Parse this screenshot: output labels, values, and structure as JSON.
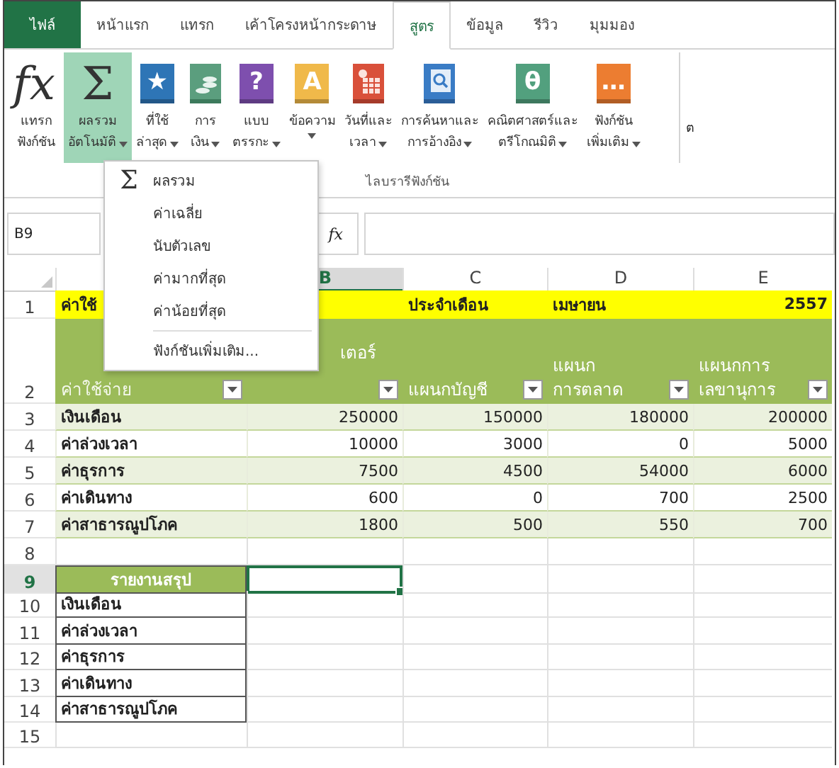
{
  "tabs": [
    {
      "label": "ไฟล์",
      "kind": "file",
      "selected": false
    },
    {
      "label": "หน้าแรก",
      "kind": "tab",
      "selected": false
    },
    {
      "label": "แทรก",
      "kind": "tab",
      "selected": false
    },
    {
      "label": "เค้าโครงหน้ากระดาษ",
      "kind": "tab",
      "selected": false
    },
    {
      "label": "สูตร",
      "kind": "tab",
      "selected": true
    },
    {
      "label": "ข้อมูล",
      "kind": "tab",
      "selected": false
    },
    {
      "label": "รีวิว",
      "kind": "tab",
      "selected": false
    },
    {
      "label": "มุมมอง",
      "kind": "tab",
      "selected": false
    }
  ],
  "ribbon": {
    "buttons": [
      {
        "kind": "plain",
        "glyph": "fx",
        "line1": "แทรก",
        "line2": "ฟังก์ชัน",
        "has_menu": false,
        "selected": false
      },
      {
        "kind": "plain",
        "glyph": "Σ",
        "line1": "ผลรวม",
        "line2": "อัตโนมัติ",
        "has_menu": true,
        "selected": true
      },
      {
        "kind": "book",
        "glyph": "★",
        "color": "#2e75b6",
        "line1": "ที่ใช้",
        "line2": "ล่าสุด",
        "has_menu": true,
        "selected": false
      },
      {
        "kind": "coins",
        "color": "#5b9e7e",
        "line1": "การ",
        "line2": "เงิน",
        "has_menu": true,
        "selected": false
      },
      {
        "kind": "book",
        "glyph": "?",
        "color": "#7e4fae",
        "line1": "แบบ",
        "line2": "ตรรกะ",
        "has_menu": true,
        "selected": false
      },
      {
        "kind": "book",
        "glyph": "A",
        "color": "#f0b94a",
        "line1": "ข้อความ",
        "has_menu": true,
        "selected": false
      },
      {
        "kind": "calendar",
        "color": "#d9503a",
        "line1": "วันที่และ",
        "line2": "เวลา",
        "has_menu": true,
        "selected": false
      },
      {
        "kind": "search",
        "color": "#3a7cc5",
        "line1": "การค้นหาและ",
        "line2": "การอ้างอิง",
        "has_menu": true,
        "selected": false
      },
      {
        "kind": "book",
        "glyph": "θ",
        "color": "#52a07e",
        "line1": "คณิตศาสตร์และ",
        "line2": "ตรีโกณมิติ",
        "has_menu": true,
        "selected": false
      },
      {
        "kind": "book",
        "glyph": "…",
        "color": "#ec7d31",
        "line1": "ฟังก์ชัน",
        "line2": "เพิ่มเติม",
        "has_menu": true,
        "selected": false
      }
    ],
    "group_label": "ไลบรารีฟังก์ชัน",
    "cut_label": "ต"
  },
  "menu": {
    "items": [
      {
        "label": "ผลรวม",
        "glyph": "Σ"
      },
      {
        "label": "ค่าเฉลี่ย"
      },
      {
        "label": "นับตัวเลข"
      },
      {
        "label": "ค่ามากที่สุด"
      },
      {
        "label": "ค่าน้อยที่สุด"
      }
    ],
    "more": "ฟังก์ชันเพิ่มเติม..."
  },
  "formula_bar": {
    "name_box": "B9",
    "fx": "fx"
  },
  "sheet": {
    "columns": [
      {
        "label": "B",
        "selected": true
      },
      {
        "label": "C",
        "selected": false
      },
      {
        "label": "D",
        "selected": false
      },
      {
        "label": "E",
        "selected": false
      }
    ],
    "rows": [
      {
        "num": "1",
        "kind": "title",
        "selected": false,
        "cells": [
          "ค่าใช้",
          null,
          "ประจำเดือน",
          "เมษายน",
          "2557"
        ]
      },
      {
        "num": "2",
        "kind": "header",
        "selected": false,
        "cells": [
          "ค่าใช้จ่าย",
          "เตอร์",
          "แผนกบัญชี",
          "แผนก\nการตลาด",
          "แผนกการ\nเลขานุการ"
        ]
      },
      {
        "num": "3",
        "kind": "data",
        "banded": true,
        "selected": false,
        "cells": [
          "เงินเดือน",
          "250000",
          "150000",
          "180000",
          "200000"
        ]
      },
      {
        "num": "4",
        "kind": "data",
        "banded": false,
        "selected": false,
        "cells": [
          "ค่าล่วงเวลา",
          "10000",
          "3000",
          "0",
          "5000"
        ]
      },
      {
        "num": "5",
        "kind": "data",
        "banded": true,
        "selected": false,
        "cells": [
          "ค่าธุรการ",
          "7500",
          "4500",
          "54000",
          "6000"
        ]
      },
      {
        "num": "6",
        "kind": "data",
        "banded": false,
        "selected": false,
        "cells": [
          "ค่าเดินทาง",
          "600",
          "0",
          "700",
          "2500"
        ]
      },
      {
        "num": "7",
        "kind": "data",
        "banded": true,
        "selected": false,
        "cells": [
          "ค่าสาธารณูปโภค",
          "1800",
          "500",
          "550",
          "700"
        ]
      },
      {
        "num": "8",
        "kind": "blank",
        "selected": false,
        "cells": [
          null,
          null,
          null,
          null,
          null
        ]
      },
      {
        "num": "9",
        "kind": "summary_head",
        "selected": true,
        "cell_selected": [
          false,
          true,
          false,
          false,
          false
        ],
        "cells": [
          "รายงานสรุป",
          null,
          null,
          null,
          null
        ]
      },
      {
        "num": "10",
        "kind": "summary",
        "selected": false,
        "cells": [
          "เงินเดือน",
          null,
          null,
          null,
          null
        ]
      },
      {
        "num": "11",
        "kind": "summary",
        "selected": false,
        "cells": [
          "ค่าล่วงเวลา",
          null,
          null,
          null,
          null
        ]
      },
      {
        "num": "12",
        "kind": "summary",
        "selected": false,
        "cells": [
          "ค่าธุรการ",
          null,
          null,
          null,
          null
        ]
      },
      {
        "num": "13",
        "kind": "summary",
        "selected": false,
        "cells": [
          "ค่าเดินทาง",
          null,
          null,
          null,
          null
        ]
      },
      {
        "num": "14",
        "kind": "summary",
        "selected": false,
        "cells": [
          "ค่าสาธารณูปโภค",
          null,
          null,
          null,
          null
        ]
      },
      {
        "num": "15",
        "kind": "blank",
        "selected": false,
        "cells": [
          null,
          null,
          null,
          null,
          null
        ]
      }
    ]
  }
}
